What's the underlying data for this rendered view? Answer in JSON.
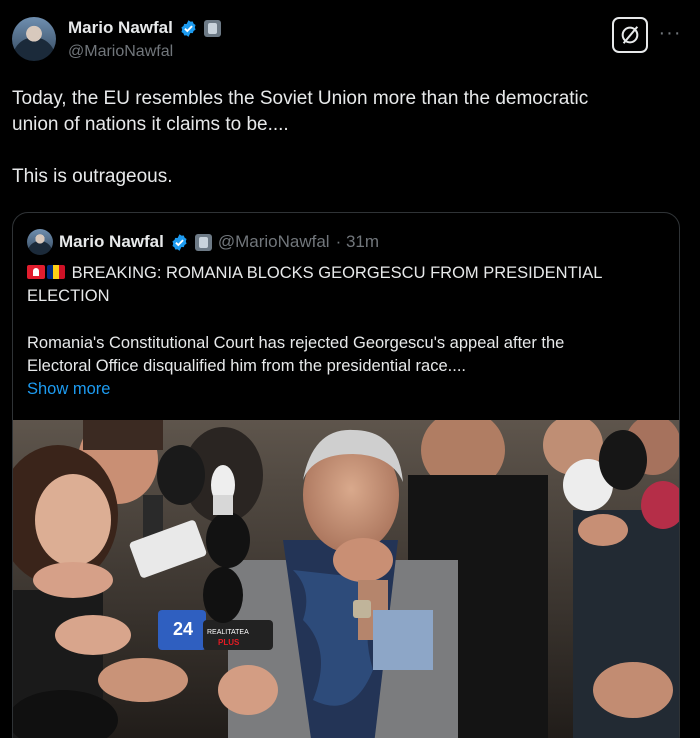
{
  "post": {
    "author_name": "Mario Nawfal",
    "handle": "@MarioNawfal",
    "text_line1": "Today, the EU resembles the Soviet Union more than the democratic",
    "text_line2": "union of nations it claims to be....",
    "text_line3": "This is outrageous."
  },
  "quote": {
    "author_name": "Mario Nawfal",
    "handle": "@MarioNawfal",
    "time": "· 31m",
    "headline_line1": "BREAKING: ROMANIA BLOCKS GEORGESCU FROM PRESIDENTIAL",
    "headline_line2": "ELECTION",
    "body_line1": "Romania's Constitutional Court has rejected Georgescu's appeal after the",
    "body_line2": "Electoral Office disqualified him from the presidential race....",
    "show_more": "Show more",
    "mic_flag_24": "24",
    "mic_flag_realitatea": "REALITATEA",
    "mic_flag_plus": "PLUS"
  },
  "icons": {
    "verified": "verified-badge-icon",
    "affiliate": "affiliate-badge-icon",
    "grok": "grok-icon",
    "more": "more-icon",
    "siren": "siren-emoji-icon",
    "flag": "romania-flag-emoji-icon"
  },
  "colors": {
    "background": "#000000",
    "text": "#e7e9ea",
    "secondary": "#71767b",
    "link": "#1d9bf0",
    "verified": "#1d9bf0",
    "border": "#2f3336"
  }
}
